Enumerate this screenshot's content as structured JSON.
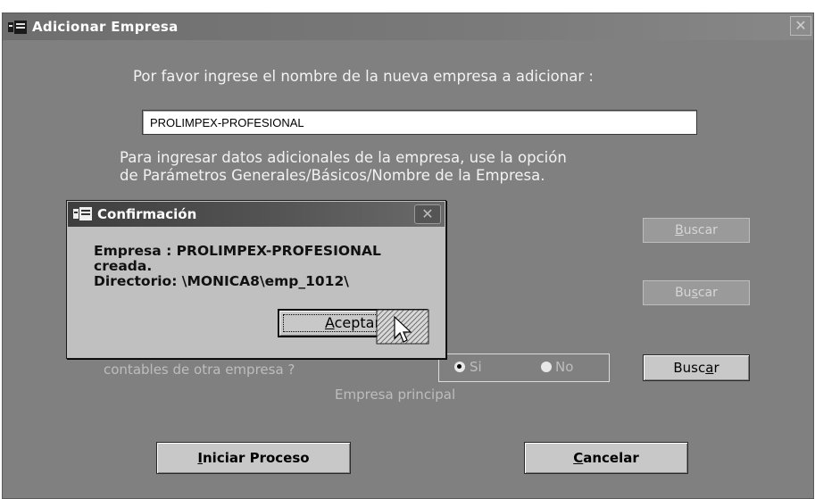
{
  "main_window": {
    "title": "Adicionar Empresa",
    "close_label": "✕",
    "prompt_text": "Por favor ingrese el nombre de la nueva empresa a adicionar :",
    "company_name_value": "PROLIMPEX-PROFESIONAL",
    "info_line1": "Para ingresar datos adicionales de la empresa, use la opción",
    "info_line2": "de Parámetros Generales/Básicos/Nombre de la Empresa.",
    "copy_question_text": "contables de otra empresa ?",
    "radio_si_label": "Si",
    "radio_no_label": "No",
    "radio_selected": "Si",
    "main_company_label": "Empresa  principal",
    "buscar1": {
      "pre": "",
      "accel": "B",
      "post": "uscar"
    },
    "buscar2": {
      "pre": "Bu",
      "accel": "s",
      "post": "car"
    },
    "buscar3": {
      "pre": "Busc",
      "accel": "a",
      "post": "r"
    },
    "iniciar": {
      "pre": "",
      "accel": "I",
      "post": "niciar Proceso"
    },
    "cancelar": {
      "pre": "",
      "accel": "C",
      "post": "ancelar"
    }
  },
  "confirm_dialog": {
    "title": "Confirmación",
    "close_label": "✕",
    "message_line1": "Empresa : PROLIMPEX-PROFESIONAL",
    "message_line2": "creada.",
    "message_line3": "Directorio: \\MONICA8\\emp_1012\\",
    "ok_button": {
      "pre": "",
      "accel": "A",
      "post": "ceptar"
    }
  },
  "icons": [
    "app-icon",
    "close-icon",
    "cursor-icon"
  ]
}
